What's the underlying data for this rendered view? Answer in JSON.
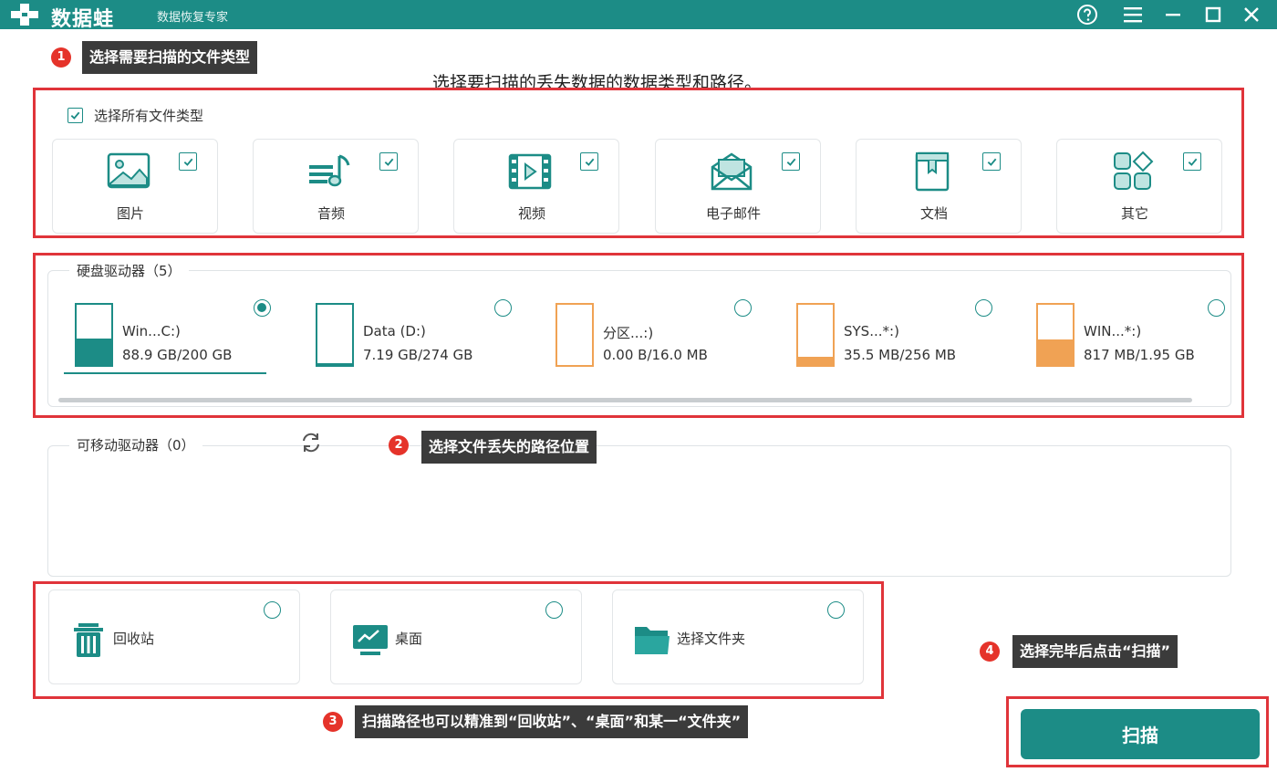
{
  "titlebar": {
    "app_name": "数据蛙",
    "subtitle": "数据恢复专家",
    "icons": [
      "plus-logo-icon",
      "help-icon",
      "menu-icon",
      "minimize-icon",
      "maximize-icon",
      "close-icon"
    ]
  },
  "annotations": [
    {
      "num": "1",
      "text": "选择需要扫描的文件类型"
    },
    {
      "num": "2",
      "text": "选择文件丢失的路径位置"
    },
    {
      "num": "3",
      "text": "扫描路径也可以精准到“回收站”、“桌面”和某一“文件夹”"
    },
    {
      "num": "4",
      "text": "选择完毕后点击“扫描”"
    }
  ],
  "heading": "选择要扫描的丢失数据的数据类型和路径。",
  "file_types": {
    "select_all_label": "选择所有文件类型",
    "select_all_checked": true,
    "items": [
      {
        "label": "图片",
        "icon": "image-icon",
        "checked": true
      },
      {
        "label": "音频",
        "icon": "audio-icon",
        "checked": true
      },
      {
        "label": "视频",
        "icon": "video-icon",
        "checked": true
      },
      {
        "label": "电子邮件",
        "icon": "email-icon",
        "checked": true
      },
      {
        "label": "文档",
        "icon": "document-icon",
        "checked": true
      },
      {
        "label": "其它",
        "icon": "other-icon",
        "checked": true
      }
    ]
  },
  "hard_drives": {
    "title": "硬盘驱动器（5）",
    "items": [
      {
        "name": "Win...C:)",
        "size": "88.9 GB/200 GB",
        "used_fraction": 0.44,
        "color": "#1c8c86",
        "selected": true
      },
      {
        "name": "Data (D:)",
        "size": "7.19 GB/274 GB",
        "used_fraction": 0.03,
        "color": "#1c8c86",
        "selected": false
      },
      {
        "name": "分区...:)",
        "size": "0.00  B/16.0 MB",
        "used_fraction": 0.0,
        "color": "#f0a254",
        "selected": false
      },
      {
        "name": "SYS...*:)",
        "size": "35.5 MB/256 MB",
        "used_fraction": 0.14,
        "color": "#f0a254",
        "selected": false
      },
      {
        "name": "WIN...*:)",
        "size": "817 MB/1.95 GB",
        "used_fraction": 0.42,
        "color": "#f0a254",
        "selected": false
      }
    ]
  },
  "removable_drives": {
    "title": "可移动驱动器（0）",
    "refresh_icon": "refresh-icon"
  },
  "locations": [
    {
      "label": "回收站",
      "icon": "recycle-bin-icon",
      "selected": false
    },
    {
      "label": "桌面",
      "icon": "desktop-icon",
      "selected": false
    },
    {
      "label": "选择文件夹",
      "icon": "folder-icon",
      "selected": false
    }
  ],
  "scan_button": "扫描",
  "colors": {
    "accent": "#1c8c86",
    "annotation_red": "#e0343a",
    "drive_orange": "#f0a254"
  }
}
